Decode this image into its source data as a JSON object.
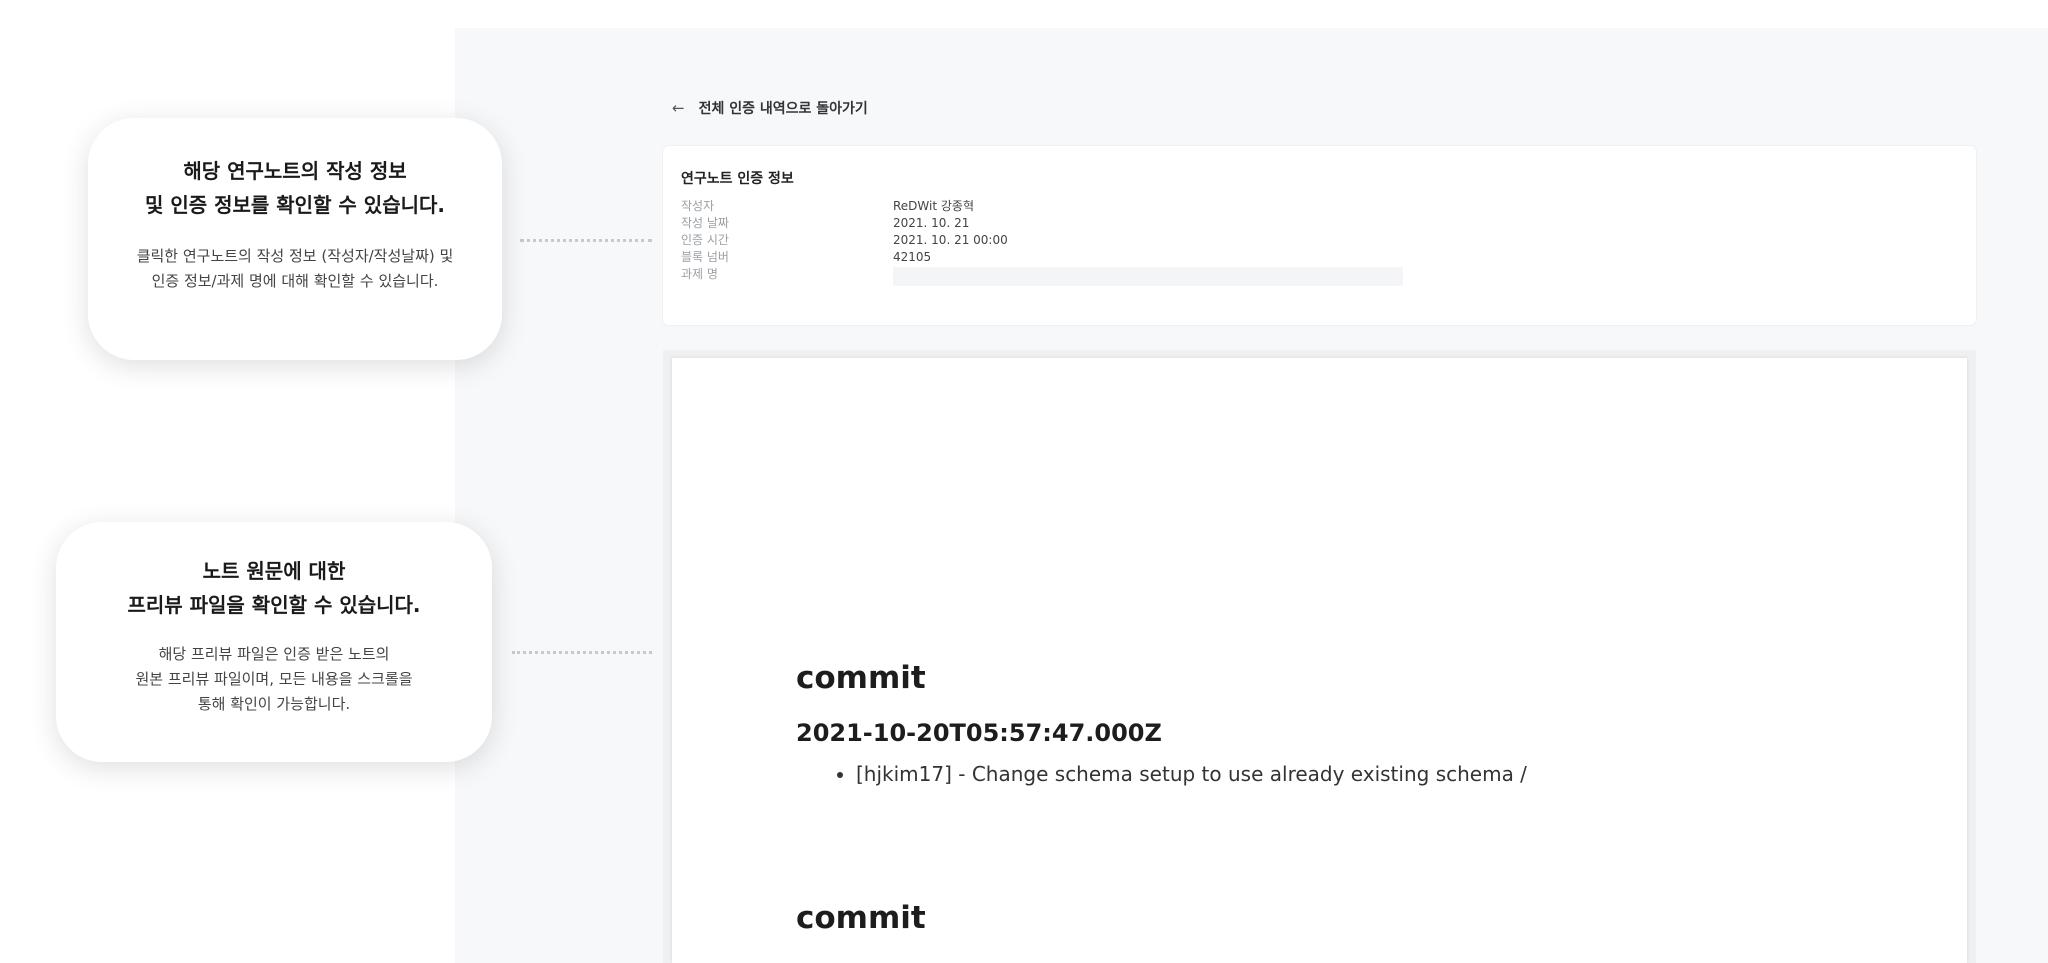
{
  "back_link": {
    "arrow": "←",
    "label": "전체 인증 내역으로 돌아가기"
  },
  "info_card": {
    "title": "연구노트 인증 정보",
    "rows": [
      {
        "label": "작성자",
        "value": "ReDWit 강종혁"
      },
      {
        "label": "작성 날짜",
        "value": "2021. 10. 21"
      },
      {
        "label": "인증 시간",
        "value": "2021. 10. 21 00:00"
      },
      {
        "label": "블록 넘버",
        "value": "42105"
      },
      {
        "label": "과제 명",
        "value": ""
      }
    ]
  },
  "preview": {
    "commits": [
      {
        "heading": "commit",
        "date": "2021-10-20T05:57:47.000Z",
        "items": [
          "[hjkim17] - Change schema setup to use already existing schema /"
        ]
      },
      {
        "heading": "commit"
      }
    ]
  },
  "callouts": [
    {
      "title_line1": "해당 연구노트의 작성 정보",
      "title_line2": "및 인증 정보를 확인할 수 있습니다.",
      "desc_line1": "클릭한 연구노트의 작성 정보 (작성자/작성날짜) 및",
      "desc_line2": "인증 정보/과제 명에 대해 확인할 수 있습니다."
    },
    {
      "title_line1": "노트 원문에 대한",
      "title_line2": "프리뷰 파일을 확인할 수 있습니다.",
      "desc_line1": "해당 프리뷰 파일은 인증 받은 노트의",
      "desc_line2": "원본 프리뷰 파일이며, 모든 내용을 스크롤을",
      "desc_line3": "통해 확인이 가능합니다."
    }
  ],
  "colors": {
    "panel_bg": "#f7f8fa",
    "card_bg": "#ffffff",
    "label_gray": "#9aa0a6",
    "connector_dots": "#c6c9cd"
  },
  "icons": {
    "back": "left-arrow-icon"
  }
}
